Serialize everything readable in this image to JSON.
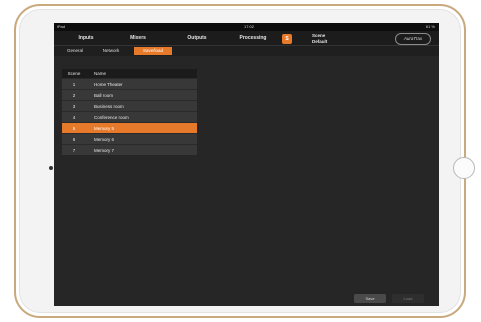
{
  "status_bar": {
    "left": "iPad",
    "time": "17:02",
    "right": "61 %"
  },
  "nav": {
    "items": [
      "Inputs",
      "Mixers",
      "Outputs",
      "Processing"
    ],
    "badge": "S",
    "scene_line1": "Scene",
    "scene_line2": "Default",
    "logo": "AuraTrax"
  },
  "subtabs": [
    "General",
    "Network",
    "Save/load"
  ],
  "table": {
    "headers": {
      "scene": "Scene",
      "name": "Name"
    },
    "rows": [
      {
        "scene": "1",
        "name": "Home Theater"
      },
      {
        "scene": "2",
        "name": "Ball room"
      },
      {
        "scene": "3",
        "name": "Business room"
      },
      {
        "scene": "4",
        "name": "Conference room"
      },
      {
        "scene": "5",
        "name": "Memory 5",
        "selected": true
      },
      {
        "scene": "6",
        "name": "Memory 6"
      },
      {
        "scene": "7",
        "name": "Memory 7"
      }
    ]
  },
  "buttons": {
    "save": "Save",
    "load": "Load"
  },
  "colors": {
    "accent": "#e7792a",
    "background": "#262626"
  }
}
